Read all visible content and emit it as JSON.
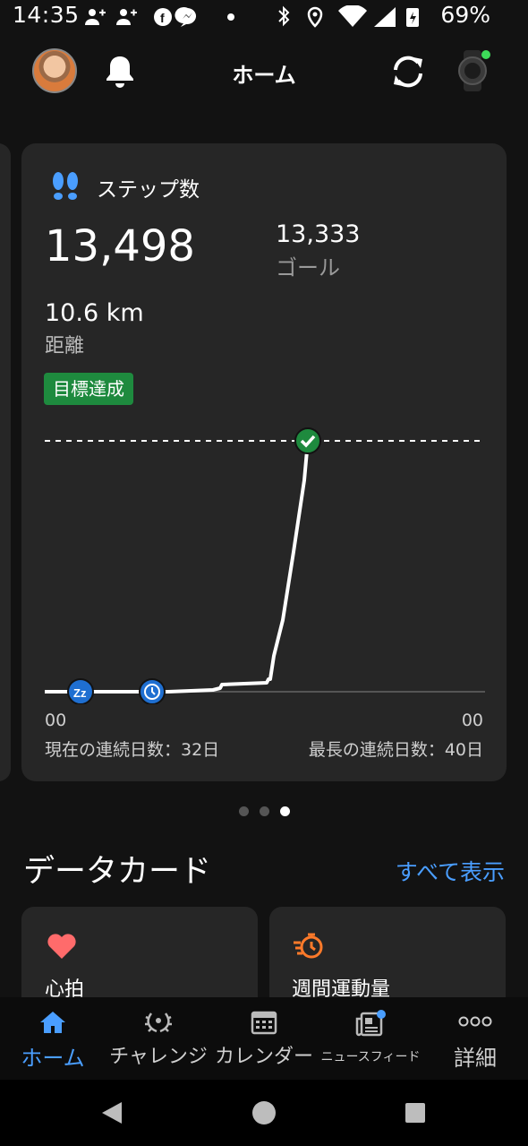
{
  "status_bar": {
    "time": "14:35",
    "battery": "69%",
    "icons": [
      "person-add-icon",
      "person-add-icon",
      "facebook-icon",
      "messenger-icon",
      "dot-icon",
      "bluetooth-icon",
      "location-icon",
      "wifi-icon",
      "signal-icon",
      "battery-icon"
    ]
  },
  "header": {
    "title": "ホーム",
    "icons": [
      "bell-icon",
      "sync-icon",
      "watch-icon"
    ],
    "watch_status_color": "#3ddc59"
  },
  "steps_card": {
    "label": "ステップ数",
    "value": "13,498",
    "goal_value": "13,333",
    "goal_label": "ゴール",
    "distance_value": "10.6 km",
    "distance_label": "距離",
    "badge": "目標達成",
    "axis_start": "00",
    "axis_end": "00",
    "streak_current": "現在の連続日数：32日",
    "streak_longest": "最長の連続日数：40日"
  },
  "carousel": {
    "page_count": 3,
    "active_index": 2
  },
  "data_cards": {
    "title": "データカード",
    "see_all": "すべて表示",
    "cards": [
      {
        "label": "心拍",
        "icon": "heart-icon",
        "icon_color": "#ff6b6b"
      },
      {
        "label": "週間運動量",
        "icon": "intensity-icon",
        "icon_color": "#ff7a2a"
      }
    ]
  },
  "bottom_nav": {
    "items": [
      {
        "label": "ホーム",
        "icon": "home-icon",
        "active": true
      },
      {
        "label": "チャレンジ",
        "icon": "laurel-icon",
        "active": false
      },
      {
        "label": "カレンダー",
        "icon": "calendar-icon",
        "active": false
      },
      {
        "label": "ニュースフィード",
        "icon": "newsfeed-icon",
        "active": false
      },
      {
        "label": "詳細",
        "icon": "more-icon",
        "active": false
      }
    ],
    "accent_color": "#4a9eff"
  },
  "system_nav": [
    "back-icon",
    "home-circle-icon",
    "recents-icon"
  ],
  "colors": {
    "goal_line": "#ffffff",
    "badge": "#1e8a3e",
    "marker": "#1f6fd1",
    "goal_marker": "#1e8a3e"
  }
}
